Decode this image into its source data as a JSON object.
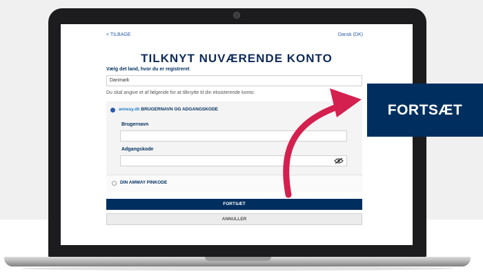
{
  "screen": {
    "back_link": "< TILBAGE",
    "language": "Dansk (DK)",
    "title": "TILKNYT NUVÆRENDE KONTO",
    "country_label": "Vælg det land, hvor du er registreret",
    "country_value": "Danmark",
    "info_text": "Du skal angive et af følgende for at tilknytte til din eksisterende konto:",
    "option1": {
      "brand": "amway.dk",
      "label": "BRUGERNAVN OG ADGANGSKODE",
      "selected": true
    },
    "username_label": "Brugernavn",
    "username_value": "",
    "password_label": "Adgangskode",
    "password_value": "",
    "option2": {
      "label": "DIN AMWAY PINKODE",
      "selected": false
    },
    "continue_button": "FORTSÆT",
    "cancel_button": "ANNULLER"
  },
  "callout": {
    "label": "FORTSÆT"
  },
  "colors": {
    "brand_navy": "#002f5f",
    "arrow": "#d4204f"
  },
  "icons": {
    "eye": "eye-slash-icon",
    "camera": "camera-icon"
  }
}
